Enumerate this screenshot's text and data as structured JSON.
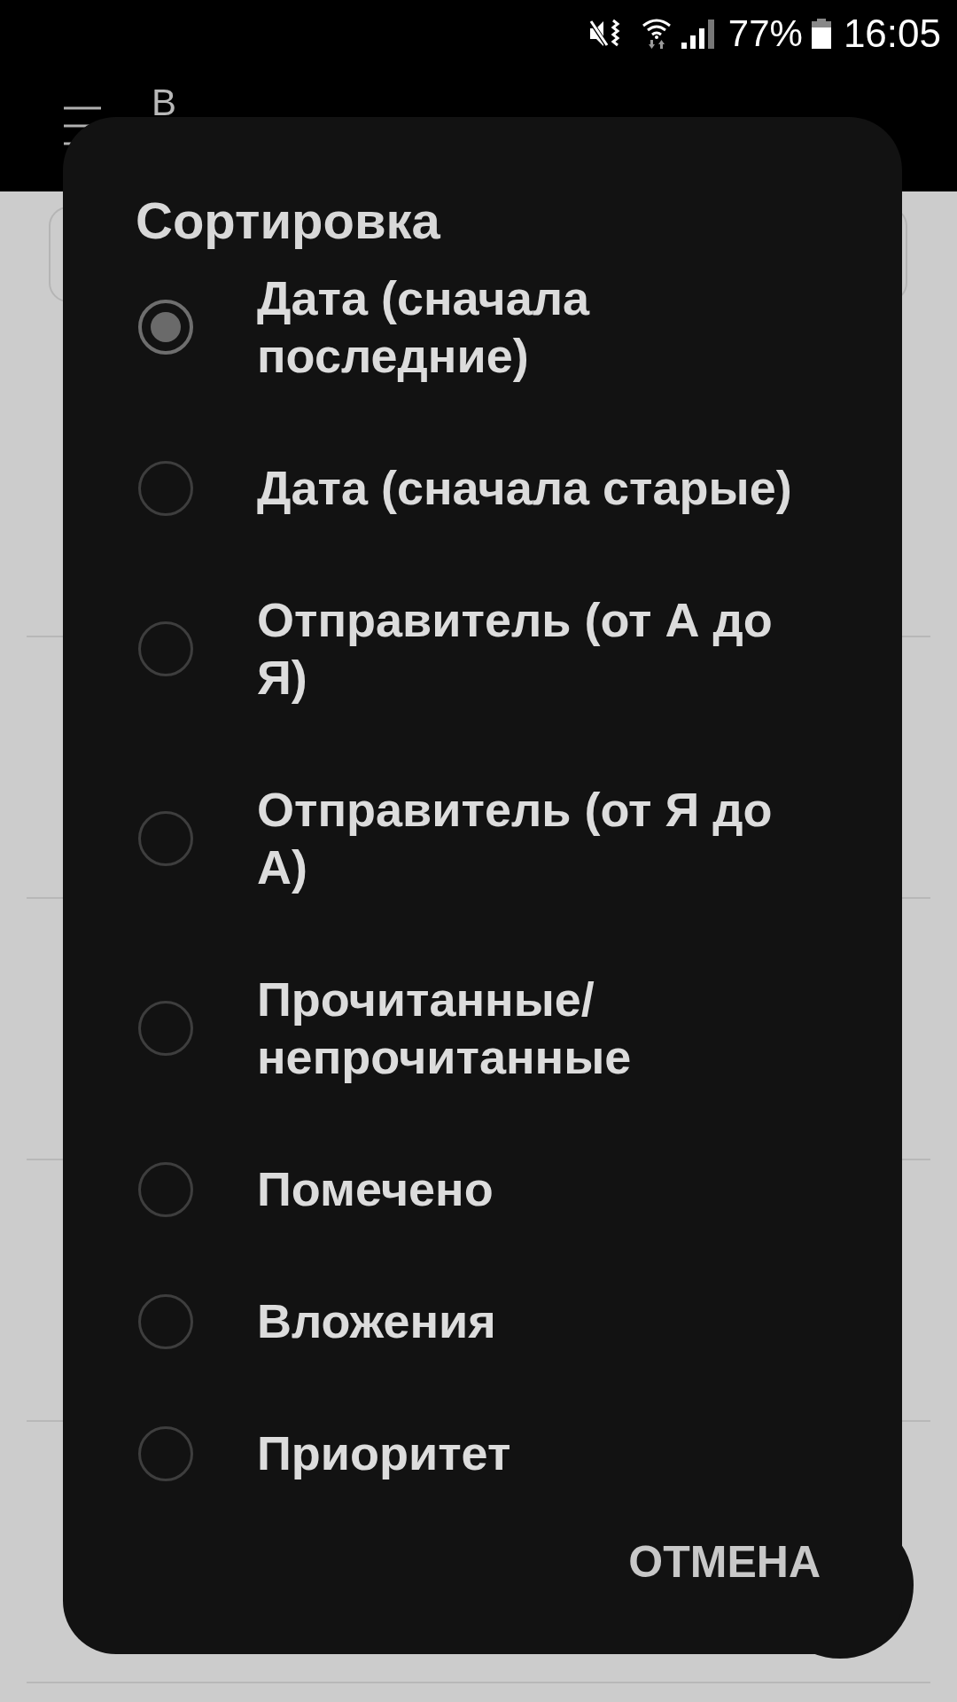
{
  "status_bar": {
    "battery_text": "77%",
    "time": "16:05"
  },
  "app_bar": {
    "title": "В"
  },
  "dialog": {
    "title": "Сортировка",
    "options": [
      {
        "label": "Дата (сначала последние)",
        "selected": true
      },
      {
        "label": "Дата (сначала старые)",
        "selected": false
      },
      {
        "label": "Отправитель (от А до Я)",
        "selected": false
      },
      {
        "label": "Отправитель (от Я до А)",
        "selected": false
      },
      {
        "label": "Прочитанные/непрочитанные",
        "selected": false
      },
      {
        "label": "Помечено",
        "selected": false
      },
      {
        "label": "Вложения",
        "selected": false
      },
      {
        "label": "Приоритет",
        "selected": false
      }
    ],
    "buttons": [
      "ОТМЕНА"
    ]
  }
}
